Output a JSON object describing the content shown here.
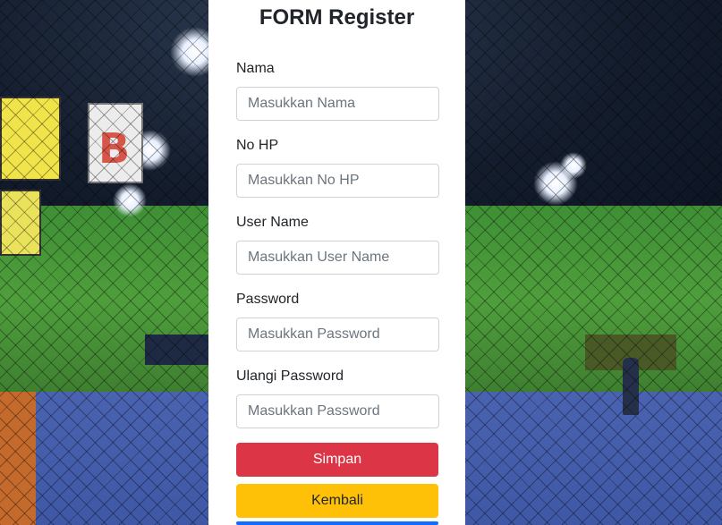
{
  "form": {
    "title": "FORM Register",
    "fields": [
      {
        "label": "Nama",
        "placeholder": "Masukkan Nama"
      },
      {
        "label": "No HP",
        "placeholder": "Masukkan No HP"
      },
      {
        "label": "User Name",
        "placeholder": "Masukkan User Name"
      },
      {
        "label": "Password",
        "placeholder": "Masukkan Password"
      },
      {
        "label": "Ulangi Password",
        "placeholder": "Masukkan Password"
      }
    ],
    "buttons": {
      "save_label": "Simpan",
      "back_label": "Kembali"
    }
  },
  "background": {
    "sign_letter": "B"
  },
  "colors": {
    "save": "#dc3545",
    "back": "#ffc107",
    "third": "#0d6efd"
  }
}
